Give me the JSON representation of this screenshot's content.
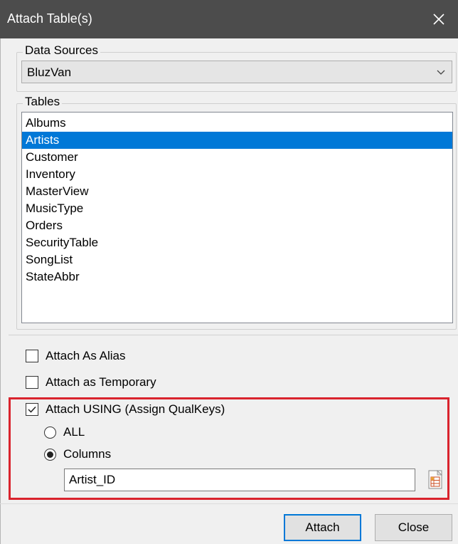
{
  "window": {
    "title": "Attach Table(s)",
    "close_glyph": "✕"
  },
  "data_sources": {
    "label": "Data Sources",
    "selected": "BluzVan",
    "arrow_icon": "chevron-down-icon"
  },
  "tables": {
    "label": "Tables",
    "items": [
      "Albums",
      "Artists",
      "Customer",
      "Inventory",
      "MasterView",
      "MusicType",
      "Orders",
      "SecurityTable",
      "SongList",
      "StateAbbr"
    ],
    "selected_index": 1
  },
  "options": {
    "attach_as_alias": {
      "label": "Attach As Alias",
      "checked": false
    },
    "attach_as_temporary": {
      "label": "Attach as Temporary",
      "checked": false
    },
    "attach_using": {
      "label": "Attach USING (Assign QualKeys)",
      "checked": true
    },
    "radio_all": {
      "label": "ALL",
      "selected": false
    },
    "radio_columns": {
      "label": "Columns",
      "selected": true
    },
    "columns_value": "Artist_ID"
  },
  "buttons": {
    "attach": "Attach",
    "close": "Close"
  },
  "colors": {
    "title_bar": "#4c4c4c",
    "selection": "#0078d7",
    "highlight_border": "#d9232d",
    "dialog_bg": "#f0f0f0"
  }
}
